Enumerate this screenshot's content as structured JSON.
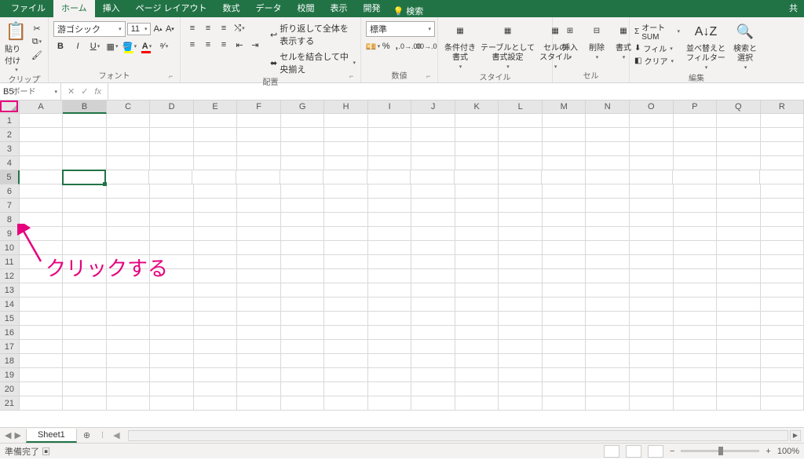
{
  "tabs": [
    "ファイル",
    "ホーム",
    "挿入",
    "ページ レイアウト",
    "数式",
    "データ",
    "校閲",
    "表示",
    "開発"
  ],
  "search_label": "検索",
  "share_label": "共",
  "clipboard": {
    "paste": "貼り付け",
    "label": "クリップボード"
  },
  "font": {
    "name": "游ゴシック",
    "size": "11",
    "label": "フォント"
  },
  "alignment": {
    "label": "配置",
    "wrap": "折り返して全体を表示する",
    "merge": "セルを結合して中央揃え"
  },
  "number": {
    "format": "標準",
    "label": "数値"
  },
  "styles": {
    "cond": "条件付き\n書式",
    "table": "テーブルとして\n書式設定",
    "cell": "セルの\nスタイル",
    "label": "スタイル"
  },
  "cells": {
    "insert": "挿入",
    "delete": "削除",
    "format": "書式",
    "label": "セル"
  },
  "editing": {
    "autosum": "オート SUM",
    "fill": "フィル",
    "clear": "クリア",
    "sort": "並べ替えと\nフィルター",
    "find": "検索と\n選択",
    "label": "編集"
  },
  "namebox": "B5",
  "columns": [
    "A",
    "B",
    "C",
    "D",
    "E",
    "F",
    "G",
    "H",
    "I",
    "J",
    "K",
    "L",
    "M",
    "N",
    "O",
    "P",
    "Q",
    "R"
  ],
  "rows": [
    "1",
    "2",
    "3",
    "4",
    "5",
    "6",
    "7",
    "8",
    "9",
    "10",
    "11",
    "12",
    "13",
    "14",
    "15",
    "16",
    "17",
    "18",
    "19",
    "20",
    "21"
  ],
  "selected_col": "B",
  "selected_row": "5",
  "sheet": "Sheet1",
  "status": "準備完了",
  "zoom": "100%",
  "annotation": "クリックする"
}
